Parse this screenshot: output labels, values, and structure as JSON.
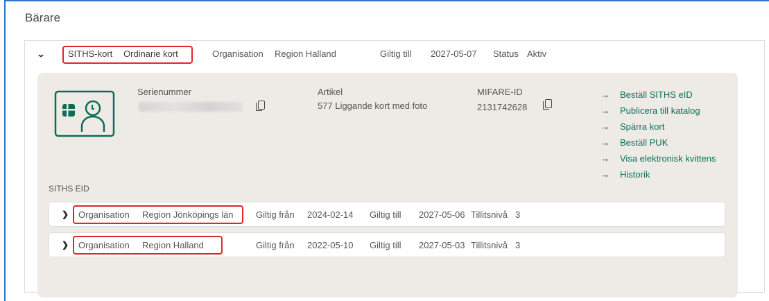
{
  "section_title": "Bärare",
  "card": {
    "type_label": "SITHS-kort",
    "type_value": "Ordinarie kort",
    "org_label": "Organisation",
    "org_value": "Region Halland",
    "valid_label": "Giltig till",
    "valid_value": "2027-05-07",
    "status_label": "Status",
    "status_value": "Aktiv"
  },
  "details": {
    "serial_label": "Serienummer",
    "article_label": "Artikel",
    "article_value": "577 Liggande kort med foto",
    "mifare_label": "MIFARE-ID",
    "mifare_value": "2131742628"
  },
  "actions": [
    {
      "label": "Beställ SITHS eID"
    },
    {
      "label": "Publicera till katalog"
    },
    {
      "label": "Spärra kort"
    },
    {
      "label": "Beställ PUK"
    },
    {
      "label": "Visa elektronisk kvittens"
    },
    {
      "label": "Historik"
    }
  ],
  "eid_heading": "SITHS EID",
  "eids": [
    {
      "org_label": "Organisation",
      "org_value": "Region Jönköpings län",
      "from_label": "Giltig från",
      "from_value": "2024-02-14",
      "to_label": "Giltig till",
      "to_value": "2027-05-06",
      "level_label": "Tillitsnivå",
      "level_value": "3"
    },
    {
      "org_label": "Organisation",
      "org_value": "Region Halland",
      "from_label": "Giltig från",
      "from_value": "2022-05-10",
      "to_label": "Giltig till",
      "to_value": "2027-05-03",
      "level_label": "Tillitsnivå",
      "level_value": "3"
    }
  ],
  "colors": {
    "accent": "#0a6e57",
    "highlight": "#e0262d",
    "panel": "#eeebe7"
  }
}
